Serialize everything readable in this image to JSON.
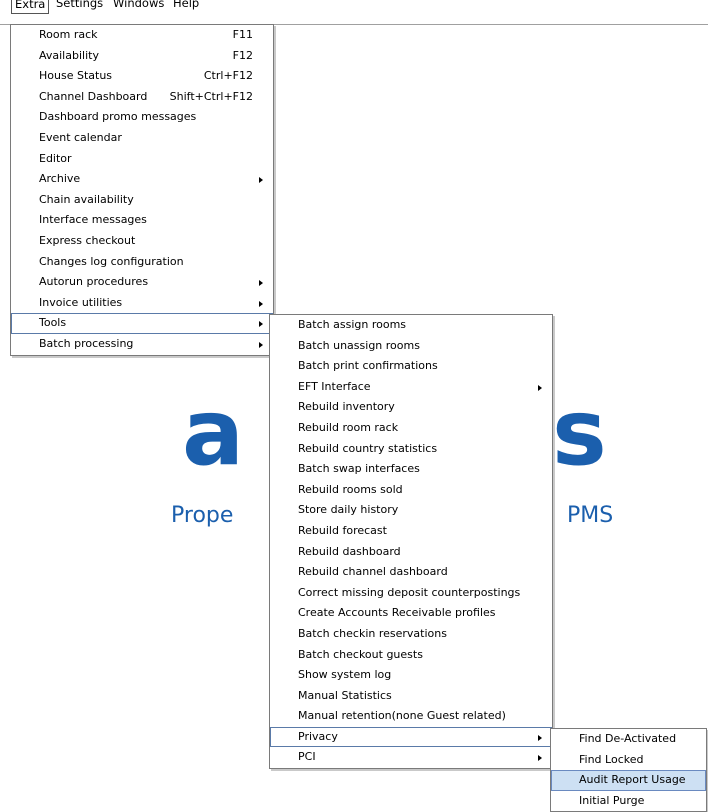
{
  "menubar": {
    "items": [
      "Extra",
      "Settings",
      "Windows",
      "Help"
    ]
  },
  "brand": {
    "logo_left": "a",
    "logo_right": "s",
    "tagline_left": "Prope",
    "tagline_right": "PMS"
  },
  "extra_menu": {
    "items": [
      {
        "label": "Room rack",
        "shortcut": "F11"
      },
      {
        "label": "Availability",
        "shortcut": "F12"
      },
      {
        "label": "House Status",
        "shortcut": "Ctrl+F12"
      },
      {
        "label": "Channel Dashboard",
        "shortcut": "Shift+Ctrl+F12"
      },
      {
        "label": "Dashboard promo messages"
      },
      {
        "label": "Event calendar"
      },
      {
        "label": "Editor"
      },
      {
        "label": "Archive"
      },
      {
        "label": "Chain availability"
      },
      {
        "label": "Interface messages"
      },
      {
        "label": "Express checkout"
      },
      {
        "label": "Changes log configuration"
      },
      {
        "label": "Autorun procedures"
      },
      {
        "label": "Invoice utilities"
      },
      {
        "label": "Tools"
      },
      {
        "label": "Batch processing"
      }
    ]
  },
  "tools_menu": {
    "items": [
      {
        "label": "Batch assign rooms"
      },
      {
        "label": "Batch unassign rooms"
      },
      {
        "label": "Batch print confirmations"
      },
      {
        "label": "EFT Interface"
      },
      {
        "label": "Rebuild inventory"
      },
      {
        "label": "Rebuild room rack"
      },
      {
        "label": "Rebuild country statistics"
      },
      {
        "label": "Batch swap interfaces"
      },
      {
        "label": "Rebuild rooms sold"
      },
      {
        "label": "Store daily history"
      },
      {
        "label": "Rebuild forecast"
      },
      {
        "label": "Rebuild dashboard"
      },
      {
        "label": "Rebuild channel dashboard"
      },
      {
        "label": "Correct missing deposit counterpostings"
      },
      {
        "label": "Create Accounts Receivable profiles"
      },
      {
        "label": "Batch checkin reservations"
      },
      {
        "label": "Batch checkout guests"
      },
      {
        "label": "Show system log"
      },
      {
        "label": "Manual Statistics"
      },
      {
        "label": "Manual retention(none Guest related)"
      },
      {
        "label": "Privacy"
      },
      {
        "label": "PCI"
      }
    ]
  },
  "privacy_menu": {
    "items": [
      {
        "label": "Find De-Activated"
      },
      {
        "label": "Find Locked"
      },
      {
        "label": "Audit Report Usage"
      },
      {
        "label": "Initial Purge"
      }
    ]
  }
}
